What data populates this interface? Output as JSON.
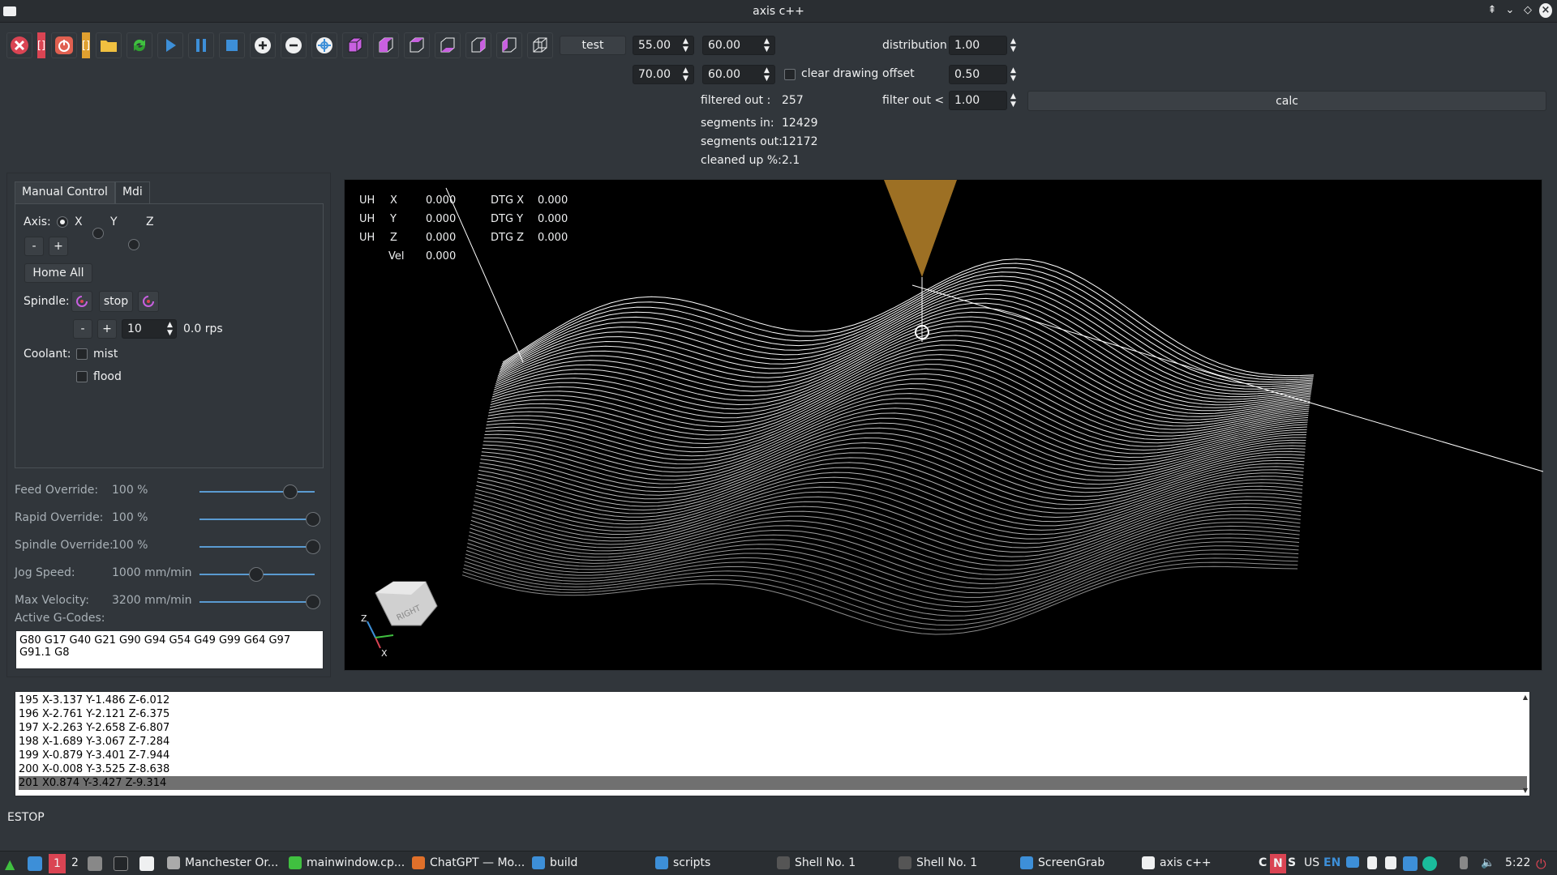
{
  "window": {
    "title": "axis c++"
  },
  "toolbar": {
    "bracket": "[]",
    "test_label": "test",
    "spin1": "55.00",
    "spin2": "60.00",
    "spin3": "70.00",
    "spin4": "60.00",
    "clear_drawing_label": "clear drawing",
    "distribution_label": "distribution",
    "distribution_value": "1.00",
    "offset_label": "offset",
    "offset_value": "0.50",
    "filter_label": "filter out <",
    "filter_value": "1.00",
    "calc_label": "calc",
    "filtered_out_label": "filtered out :",
    "filtered_out_value": "257",
    "segments_in_label": "segments in:",
    "segments_in_value": "12429",
    "segments_out_label": "segments out:",
    "segments_out_value": "12172",
    "cleaned_label": "cleaned up %:",
    "cleaned_value": "2.1"
  },
  "manual": {
    "tab_manual": "Manual Control",
    "tab_mdi": "Mdi",
    "axis_label": "Axis:",
    "axis_x": "X",
    "axis_y": "Y",
    "axis_z": "Z",
    "minus": "-",
    "plus": "+",
    "home_all": "Home All",
    "spindle_label": "Spindle:",
    "spindle_stop": "stop",
    "spindle_speed": "10",
    "spindle_rps": "0.0 rps",
    "coolant_label": "Coolant:",
    "mist": "mist",
    "flood": "flood"
  },
  "overrides": [
    {
      "label": "Feed Override:",
      "value": "100 %",
      "level": 0.8
    },
    {
      "label": "Rapid Override:",
      "value": "100 %",
      "level": 1.0
    },
    {
      "label": "Spindle Override:",
      "value": "100 %",
      "level": 1.0
    },
    {
      "label": "Jog Speed:",
      "value": "1000 mm/min",
      "level": 0.5
    },
    {
      "label": "Max Velocity:",
      "value": "3200 mm/min",
      "level": 1.0
    }
  ],
  "gcodes": {
    "label": "Active G-Codes:",
    "line1": "G80 G17 G40 G21 G90 G94 G54 G49 G99 G64 G97",
    "line2": "G91.1 G8"
  },
  "dro": {
    "uh": "UH",
    "x_label": "X",
    "x_value": "0.000",
    "y_label": "Y",
    "y_value": "0.000",
    "z_label": "Z",
    "z_value": "0.000",
    "vel_label": "Vel",
    "vel_value": "0.000",
    "dtgx_label": "DTG X",
    "dtgx_value": "0.000",
    "dtgy_label": "DTG Y",
    "dtgy_value": "0.000",
    "dtgz_label": "DTG Z",
    "dtgz_value": "0.000"
  },
  "viewcube": {
    "face": "RIGHT",
    "axis_z": "Z",
    "axis_x": "X"
  },
  "code_lines": [
    {
      "num": "195",
      "text": "X-3.137 Y-1.486 Z-6.012"
    },
    {
      "num": "196",
      "text": "X-2.761 Y-2.121 Z-6.375"
    },
    {
      "num": "197",
      "text": "X-2.263 Y-2.658 Z-6.807"
    },
    {
      "num": "198",
      "text": "X-1.689 Y-3.067 Z-7.284"
    },
    {
      "num": "199",
      "text": "X-0.879 Y-3.401 Z-7.944"
    },
    {
      "num": "200",
      "text": "X-0.008 Y-3.525 Z-8.638"
    },
    {
      "num": "201",
      "text": "X0.874 Y-3.427 Z-9.314"
    }
  ],
  "status": "ESTOP",
  "taskbar": {
    "ws1": "1",
    "ws2": "2",
    "apps": [
      "Manchester Or...",
      "mainwindow.cp...",
      "ChatGPT — Mo...",
      "build",
      "scripts",
      "Shell No. 1",
      "Shell No. 1",
      "ScreenGrab",
      "axis c++"
    ],
    "tray_c": "C",
    "tray_n": "N",
    "tray_s": "S",
    "kb_us": "US",
    "kb_en": "EN",
    "clock": "5:22"
  },
  "colors": {
    "accent": "#5a9bd1",
    "estop_red": "#da4453",
    "tool_orange": "#e0a030",
    "view_magenta": "#c860e0"
  }
}
